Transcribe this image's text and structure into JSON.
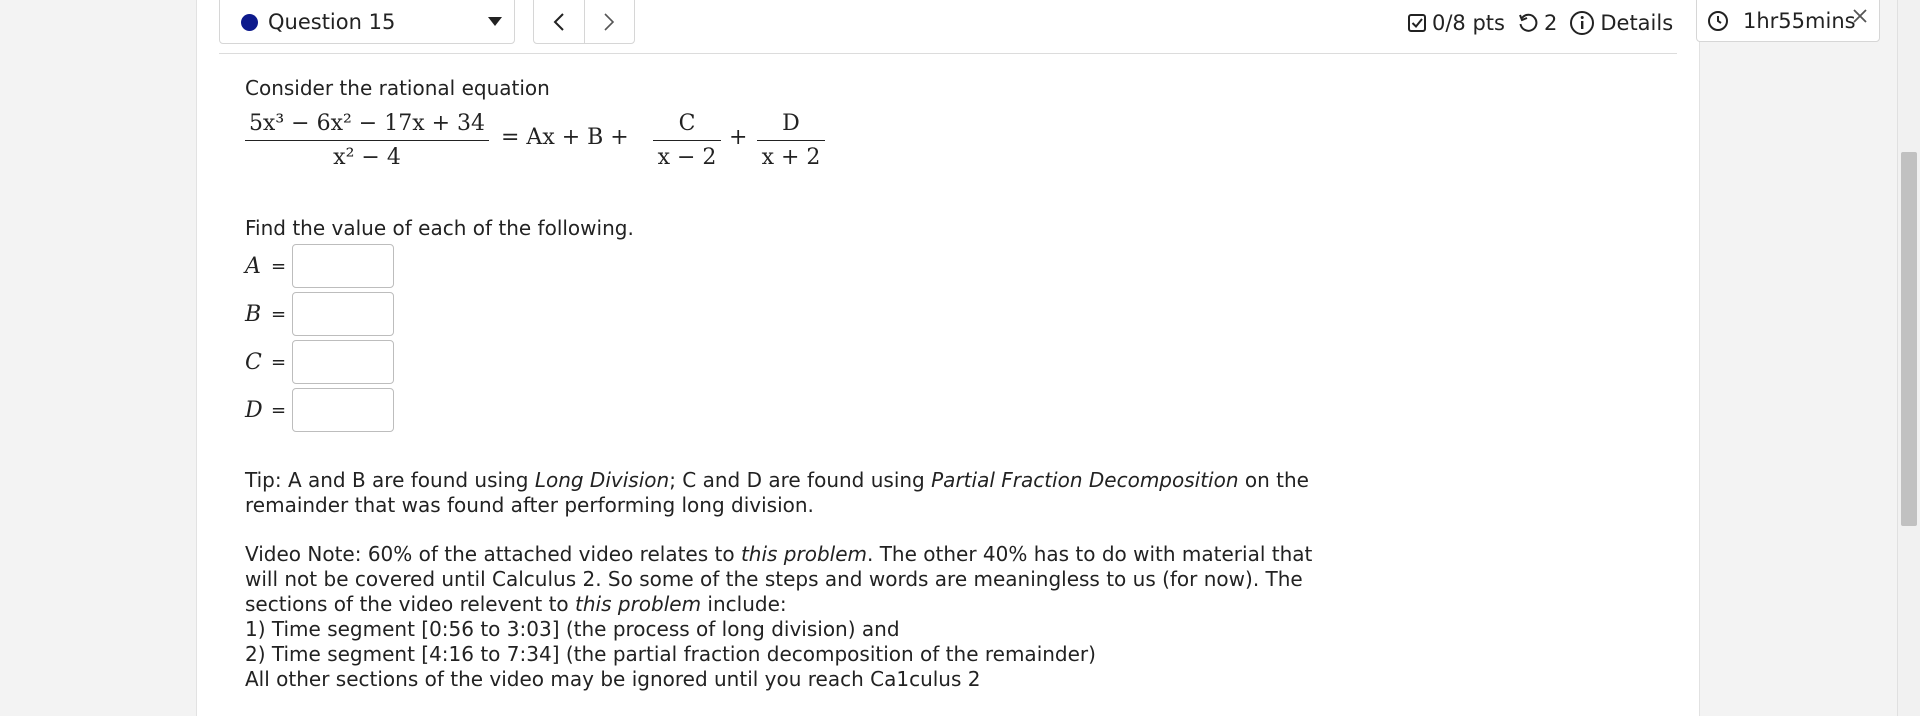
{
  "question": {
    "label": "Question 15",
    "dot_color": "#0d1a8c"
  },
  "status": {
    "points": "0/8 pts",
    "attempts": "2",
    "details": "Details"
  },
  "timer": {
    "text": "1hr55mins"
  },
  "problem": {
    "intro": "Consider the rational equation",
    "equation": {
      "numerator": "5x³ − 6x² − 17x + 34",
      "denominator": "x² − 4",
      "equals": "= Ax + B +",
      "frac_c_num": "C",
      "frac_c_den": "x − 2",
      "plus": "+",
      "frac_d_num": "D",
      "frac_d_den": "x + 2"
    },
    "find_text": "Find the value of each of the following.",
    "answers": [
      {
        "var": "A",
        "eq": "=",
        "value": ""
      },
      {
        "var": "B",
        "eq": "=",
        "value": ""
      },
      {
        "var": "C",
        "eq": "=",
        "value": ""
      },
      {
        "var": "D",
        "eq": "=",
        "value": ""
      }
    ],
    "tip": {
      "p1": "Tip: A and B are found using ",
      "em1": "Long Division",
      "p2": "; C and D are found using ",
      "em2": "Partial Fraction Decomposition",
      "p3": " on the remainder that was found after performing long division."
    },
    "video": {
      "p1": "Video Note: 60% of the attached video relates to ",
      "em1": "this problem",
      "p2": ". The other 40% has to do with material that will not be covered until Calculus 2. So some of the steps and words are meaningless to us (for now). The sections of the video relevent to ",
      "em2": "this problem",
      "p3": " include:",
      "line1": "1) Time segment [0:56 to 3:03] (the process of long division) and",
      "line2": "2) Time segment [4:16 to 7:34] (the partial fraction decomposition of the remainder)",
      "line3": "All other sections of the video may be ignored until you reach Ca1culus 2"
    }
  }
}
